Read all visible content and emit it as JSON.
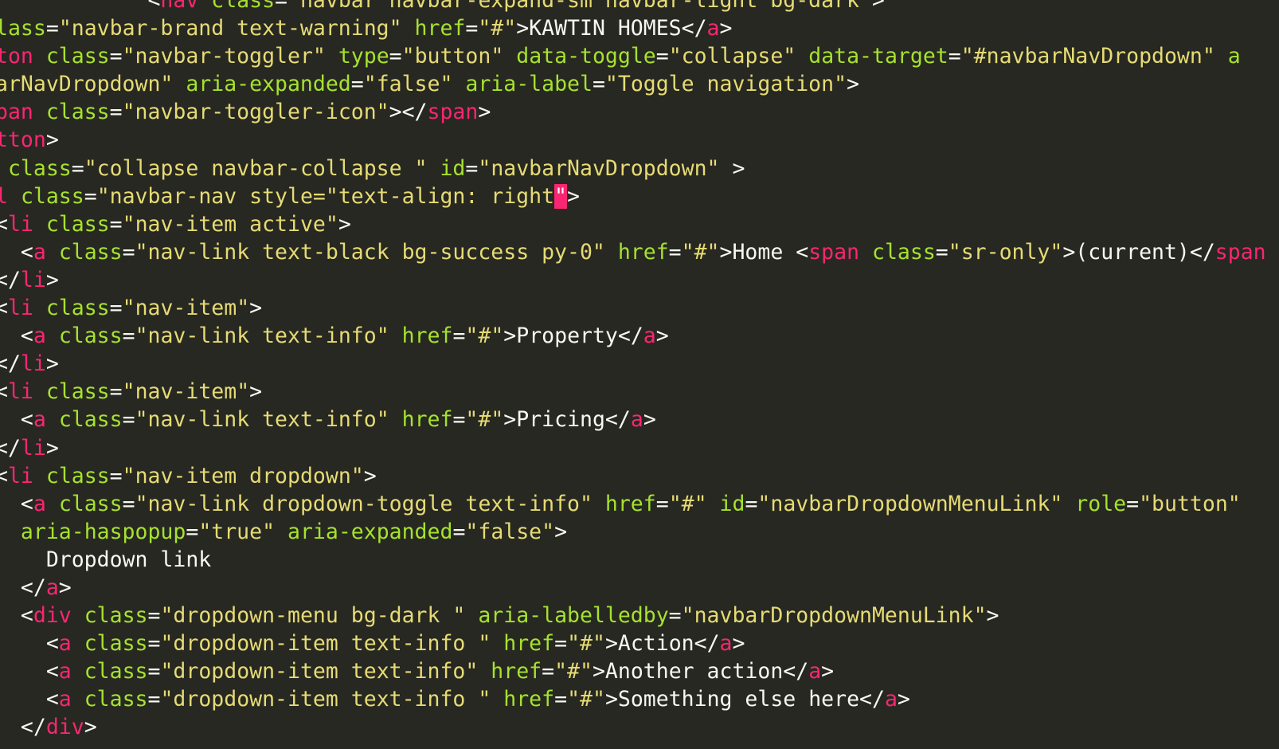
{
  "editor": {
    "theme_colors": {
      "background": "#272822",
      "tag": "#F92672",
      "attribute": "#A6E22E",
      "string": "#E6DB74",
      "text": "#F8F8F2",
      "cursor_highlight": "#F92672"
    },
    "lines": [
      [
        {
          "c": "p",
          "t": "            <"
        },
        {
          "c": "t",
          "t": "nav"
        },
        {
          "c": "p",
          "t": " "
        },
        {
          "c": "a",
          "t": "class"
        },
        {
          "c": "p",
          "t": "="
        },
        {
          "c": "s",
          "t": "\"navbar navbar-expand-sm navbar-light bg-dark\""
        },
        {
          "c": "p",
          "t": ">"
        }
      ],
      [
        {
          "c": "a",
          "t": "lass"
        },
        {
          "c": "p",
          "t": "="
        },
        {
          "c": "s",
          "t": "\"navbar-brand text-warning\""
        },
        {
          "c": "p",
          "t": " "
        },
        {
          "c": "a",
          "t": "href"
        },
        {
          "c": "p",
          "t": "="
        },
        {
          "c": "s",
          "t": "\"#\""
        },
        {
          "c": "p",
          "t": ">KAWTIN HOMES</"
        },
        {
          "c": "t",
          "t": "a"
        },
        {
          "c": "p",
          "t": ">"
        }
      ],
      [
        {
          "c": "t",
          "t": "ton"
        },
        {
          "c": "p",
          "t": " "
        },
        {
          "c": "a",
          "t": "class"
        },
        {
          "c": "p",
          "t": "="
        },
        {
          "c": "s",
          "t": "\"navbar-toggler\""
        },
        {
          "c": "p",
          "t": " "
        },
        {
          "c": "a",
          "t": "type"
        },
        {
          "c": "p",
          "t": "="
        },
        {
          "c": "s",
          "t": "\"button\""
        },
        {
          "c": "p",
          "t": " "
        },
        {
          "c": "a",
          "t": "data-toggle"
        },
        {
          "c": "p",
          "t": "="
        },
        {
          "c": "s",
          "t": "\"collapse\""
        },
        {
          "c": "p",
          "t": " "
        },
        {
          "c": "a",
          "t": "data-target"
        },
        {
          "c": "p",
          "t": "="
        },
        {
          "c": "s",
          "t": "\"#navbarNavDropdown\""
        },
        {
          "c": "p",
          "t": " "
        },
        {
          "c": "a",
          "t": "a"
        }
      ],
      [
        {
          "c": "s",
          "t": "arNavDropdown\""
        },
        {
          "c": "p",
          "t": " "
        },
        {
          "c": "a",
          "t": "aria-expanded"
        },
        {
          "c": "p",
          "t": "="
        },
        {
          "c": "s",
          "t": "\"false\""
        },
        {
          "c": "p",
          "t": " "
        },
        {
          "c": "a",
          "t": "aria-label"
        },
        {
          "c": "p",
          "t": "="
        },
        {
          "c": "s",
          "t": "\"Toggle navigation\""
        },
        {
          "c": "p",
          "t": ">"
        }
      ],
      [
        {
          "c": "t",
          "t": "pan"
        },
        {
          "c": "p",
          "t": " "
        },
        {
          "c": "a",
          "t": "class"
        },
        {
          "c": "p",
          "t": "="
        },
        {
          "c": "s",
          "t": "\"navbar-toggler-icon\""
        },
        {
          "c": "p",
          "t": "></"
        },
        {
          "c": "t",
          "t": "span"
        },
        {
          "c": "p",
          "t": ">"
        }
      ],
      [
        {
          "c": "t",
          "t": "tton"
        },
        {
          "c": "p",
          "t": ">"
        }
      ],
      [
        {
          "c": "p",
          "t": " "
        },
        {
          "c": "a",
          "t": "class"
        },
        {
          "c": "p",
          "t": "="
        },
        {
          "c": "s",
          "t": "\"collapse navbar-collapse \""
        },
        {
          "c": "p",
          "t": " "
        },
        {
          "c": "a",
          "t": "id"
        },
        {
          "c": "p",
          "t": "="
        },
        {
          "c": "s",
          "t": "\"navbarNavDropdown\""
        },
        {
          "c": "p",
          "t": " >"
        }
      ],
      [
        {
          "c": "t",
          "t": "l"
        },
        {
          "c": "p",
          "t": " "
        },
        {
          "c": "a",
          "t": "class"
        },
        {
          "c": "p",
          "t": "="
        },
        {
          "c": "s",
          "t": "\"navbar-nav style=\"text-align: right"
        },
        {
          "c": "hl",
          "t": "\""
        },
        {
          "c": "p",
          "t": ">"
        }
      ],
      [
        {
          "c": "p",
          "t": "<"
        },
        {
          "c": "t",
          "t": "li"
        },
        {
          "c": "p",
          "t": " "
        },
        {
          "c": "a",
          "t": "class"
        },
        {
          "c": "p",
          "t": "="
        },
        {
          "c": "s",
          "t": "\"nav-item active\""
        },
        {
          "c": "p",
          "t": ">"
        }
      ],
      [
        {
          "c": "p",
          "t": "  <"
        },
        {
          "c": "t",
          "t": "a"
        },
        {
          "c": "p",
          "t": " "
        },
        {
          "c": "a",
          "t": "class"
        },
        {
          "c": "p",
          "t": "="
        },
        {
          "c": "s",
          "t": "\"nav-link text-black bg-success py-0\""
        },
        {
          "c": "p",
          "t": " "
        },
        {
          "c": "a",
          "t": "href"
        },
        {
          "c": "p",
          "t": "="
        },
        {
          "c": "s",
          "t": "\"#\""
        },
        {
          "c": "p",
          "t": ">Home <"
        },
        {
          "c": "t",
          "t": "span"
        },
        {
          "c": "p",
          "t": " "
        },
        {
          "c": "a",
          "t": "class"
        },
        {
          "c": "p",
          "t": "="
        },
        {
          "c": "s",
          "t": "\"sr-only\""
        },
        {
          "c": "p",
          "t": ">(current)</"
        },
        {
          "c": "t",
          "t": "span"
        }
      ],
      [
        {
          "c": "p",
          "t": "</"
        },
        {
          "c": "t",
          "t": "li"
        },
        {
          "c": "p",
          "t": ">"
        }
      ],
      [
        {
          "c": "p",
          "t": "<"
        },
        {
          "c": "t",
          "t": "li"
        },
        {
          "c": "p",
          "t": " "
        },
        {
          "c": "a",
          "t": "class"
        },
        {
          "c": "p",
          "t": "="
        },
        {
          "c": "s",
          "t": "\"nav-item\""
        },
        {
          "c": "p",
          "t": ">"
        }
      ],
      [
        {
          "c": "p",
          "t": "  <"
        },
        {
          "c": "t",
          "t": "a"
        },
        {
          "c": "p",
          "t": " "
        },
        {
          "c": "a",
          "t": "class"
        },
        {
          "c": "p",
          "t": "="
        },
        {
          "c": "s",
          "t": "\"nav-link text-info\""
        },
        {
          "c": "p",
          "t": " "
        },
        {
          "c": "a",
          "t": "href"
        },
        {
          "c": "p",
          "t": "="
        },
        {
          "c": "s",
          "t": "\"#\""
        },
        {
          "c": "p",
          "t": ">Property</"
        },
        {
          "c": "t",
          "t": "a"
        },
        {
          "c": "p",
          "t": ">"
        }
      ],
      [
        {
          "c": "p",
          "t": "</"
        },
        {
          "c": "t",
          "t": "li"
        },
        {
          "c": "p",
          "t": ">"
        }
      ],
      [
        {
          "c": "p",
          "t": "<"
        },
        {
          "c": "t",
          "t": "li"
        },
        {
          "c": "p",
          "t": " "
        },
        {
          "c": "a",
          "t": "class"
        },
        {
          "c": "p",
          "t": "="
        },
        {
          "c": "s",
          "t": "\"nav-item\""
        },
        {
          "c": "p",
          "t": ">"
        }
      ],
      [
        {
          "c": "p",
          "t": "  <"
        },
        {
          "c": "t",
          "t": "a"
        },
        {
          "c": "p",
          "t": " "
        },
        {
          "c": "a",
          "t": "class"
        },
        {
          "c": "p",
          "t": "="
        },
        {
          "c": "s",
          "t": "\"nav-link text-info\""
        },
        {
          "c": "p",
          "t": " "
        },
        {
          "c": "a",
          "t": "href"
        },
        {
          "c": "p",
          "t": "="
        },
        {
          "c": "s",
          "t": "\"#\""
        },
        {
          "c": "p",
          "t": ">Pricing</"
        },
        {
          "c": "t",
          "t": "a"
        },
        {
          "c": "p",
          "t": ">"
        }
      ],
      [
        {
          "c": "p",
          "t": "</"
        },
        {
          "c": "t",
          "t": "li"
        },
        {
          "c": "p",
          "t": ">"
        }
      ],
      [
        {
          "c": "p",
          "t": "<"
        },
        {
          "c": "t",
          "t": "li"
        },
        {
          "c": "p",
          "t": " "
        },
        {
          "c": "a",
          "t": "class"
        },
        {
          "c": "p",
          "t": "="
        },
        {
          "c": "s",
          "t": "\"nav-item dropdown\""
        },
        {
          "c": "p",
          "t": ">"
        }
      ],
      [
        {
          "c": "p",
          "t": "  <"
        },
        {
          "c": "t",
          "t": "a"
        },
        {
          "c": "p",
          "t": " "
        },
        {
          "c": "a",
          "t": "class"
        },
        {
          "c": "p",
          "t": "="
        },
        {
          "c": "s",
          "t": "\"nav-link dropdown-toggle text-info\""
        },
        {
          "c": "p",
          "t": " "
        },
        {
          "c": "a",
          "t": "href"
        },
        {
          "c": "p",
          "t": "="
        },
        {
          "c": "s",
          "t": "\"#\""
        },
        {
          "c": "p",
          "t": " "
        },
        {
          "c": "a",
          "t": "id"
        },
        {
          "c": "p",
          "t": "="
        },
        {
          "c": "s",
          "t": "\"navbarDropdownMenuLink\""
        },
        {
          "c": "p",
          "t": " "
        },
        {
          "c": "a",
          "t": "role"
        },
        {
          "c": "p",
          "t": "="
        },
        {
          "c": "s",
          "t": "\"button\""
        }
      ],
      [
        {
          "c": "p",
          "t": "  "
        },
        {
          "c": "a",
          "t": "aria-haspopup"
        },
        {
          "c": "p",
          "t": "="
        },
        {
          "c": "s",
          "t": "\"true\""
        },
        {
          "c": "p",
          "t": " "
        },
        {
          "c": "a",
          "t": "aria-expanded"
        },
        {
          "c": "p",
          "t": "="
        },
        {
          "c": "s",
          "t": "\"false\""
        },
        {
          "c": "p",
          "t": ">"
        }
      ],
      [
        {
          "c": "p",
          "t": "    Dropdown link"
        }
      ],
      [
        {
          "c": "p",
          "t": "  </"
        },
        {
          "c": "t",
          "t": "a"
        },
        {
          "c": "p",
          "t": ">"
        }
      ],
      [
        {
          "c": "p",
          "t": "  <"
        },
        {
          "c": "t",
          "t": "div"
        },
        {
          "c": "p",
          "t": " "
        },
        {
          "c": "a",
          "t": "class"
        },
        {
          "c": "p",
          "t": "="
        },
        {
          "c": "s",
          "t": "\"dropdown-menu bg-dark \""
        },
        {
          "c": "p",
          "t": " "
        },
        {
          "c": "a",
          "t": "aria-labelledby"
        },
        {
          "c": "p",
          "t": "="
        },
        {
          "c": "s",
          "t": "\"navbarDropdownMenuLink\""
        },
        {
          "c": "p",
          "t": ">"
        }
      ],
      [
        {
          "c": "p",
          "t": "    <"
        },
        {
          "c": "t",
          "t": "a"
        },
        {
          "c": "p",
          "t": " "
        },
        {
          "c": "a",
          "t": "class"
        },
        {
          "c": "p",
          "t": "="
        },
        {
          "c": "s",
          "t": "\"dropdown-item text-info \""
        },
        {
          "c": "p",
          "t": " "
        },
        {
          "c": "a",
          "t": "href"
        },
        {
          "c": "p",
          "t": "="
        },
        {
          "c": "s",
          "t": "\"#\""
        },
        {
          "c": "p",
          "t": ">Action</"
        },
        {
          "c": "t",
          "t": "a"
        },
        {
          "c": "p",
          "t": ">"
        }
      ],
      [
        {
          "c": "p",
          "t": "    <"
        },
        {
          "c": "t",
          "t": "a"
        },
        {
          "c": "p",
          "t": " "
        },
        {
          "c": "a",
          "t": "class"
        },
        {
          "c": "p",
          "t": "="
        },
        {
          "c": "s",
          "t": "\"dropdown-item text-info\""
        },
        {
          "c": "p",
          "t": " "
        },
        {
          "c": "a",
          "t": "href"
        },
        {
          "c": "p",
          "t": "="
        },
        {
          "c": "s",
          "t": "\"#\""
        },
        {
          "c": "p",
          "t": ">Another action</"
        },
        {
          "c": "t",
          "t": "a"
        },
        {
          "c": "p",
          "t": ">"
        }
      ],
      [
        {
          "c": "p",
          "t": "    <"
        },
        {
          "c": "t",
          "t": "a"
        },
        {
          "c": "p",
          "t": " "
        },
        {
          "c": "a",
          "t": "class"
        },
        {
          "c": "p",
          "t": "="
        },
        {
          "c": "s",
          "t": "\"dropdown-item text-info \""
        },
        {
          "c": "p",
          "t": " "
        },
        {
          "c": "a",
          "t": "href"
        },
        {
          "c": "p",
          "t": "="
        },
        {
          "c": "s",
          "t": "\"#\""
        },
        {
          "c": "p",
          "t": ">Something else here</"
        },
        {
          "c": "t",
          "t": "a"
        },
        {
          "c": "p",
          "t": ">"
        }
      ],
      [
        {
          "c": "p",
          "t": "  </"
        },
        {
          "c": "t",
          "t": "div"
        },
        {
          "c": "p",
          "t": ">"
        }
      ]
    ]
  }
}
